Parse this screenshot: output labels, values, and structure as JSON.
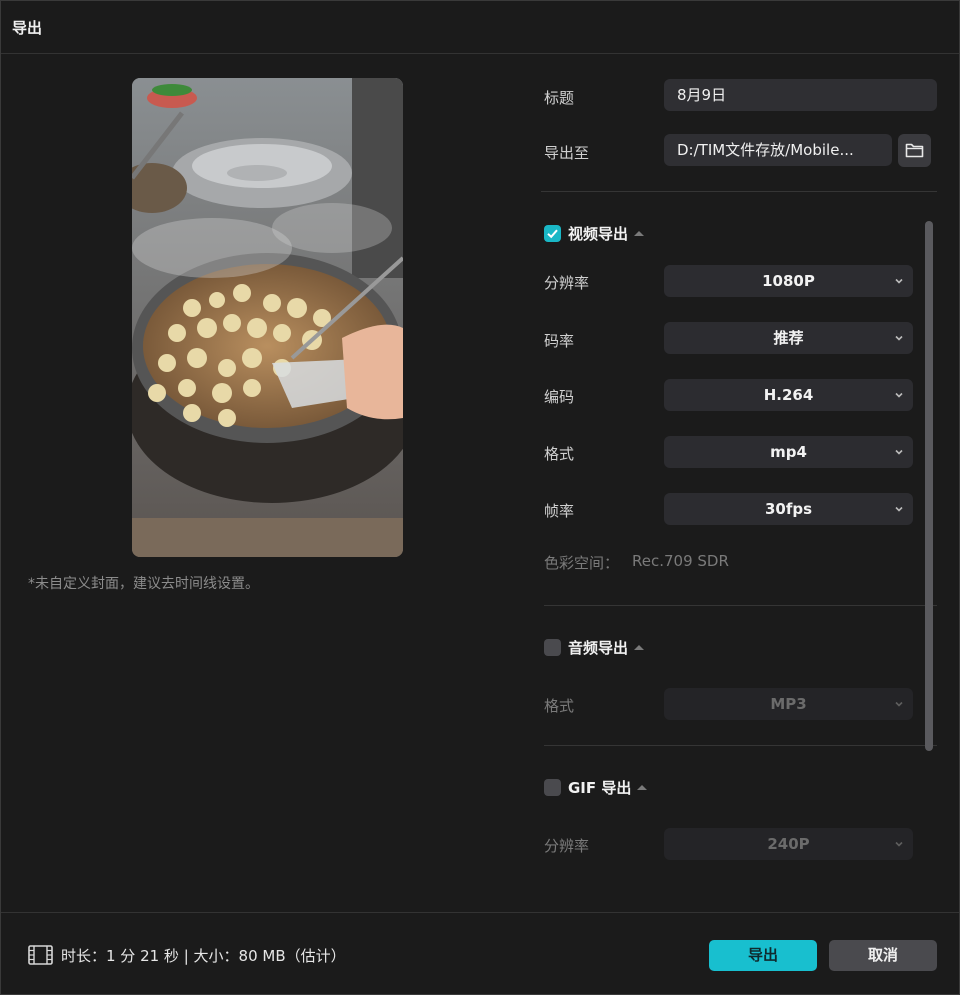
{
  "dialog": {
    "title": "导出"
  },
  "cover": {
    "note": "*未自定义封面，建议去时间线设置。"
  },
  "title_field": {
    "label": "标题",
    "value": "8月9日"
  },
  "export_to": {
    "label": "导出至",
    "value": "D:/TIM文件存放/Mobile...",
    "icon": "folder-icon"
  },
  "video": {
    "checked": true,
    "title": "视频导出",
    "resolution": {
      "label": "分辨率",
      "value": "1080P"
    },
    "bitrate": {
      "label": "码率",
      "value": "推荐"
    },
    "codec": {
      "label": "编码",
      "value": "H.264"
    },
    "format": {
      "label": "格式",
      "value": "mp4"
    },
    "framerate": {
      "label": "帧率",
      "value": "30fps"
    },
    "colorspace": {
      "label": "色彩空间：",
      "value": "Rec.709 SDR"
    }
  },
  "audio": {
    "checked": false,
    "title": "音频导出",
    "format": {
      "label": "格式",
      "value": "MP3"
    }
  },
  "gif": {
    "checked": false,
    "title": "GIF 导出",
    "resolution": {
      "label": "分辨率",
      "value": "240P"
    }
  },
  "footer": {
    "info": "时长：1 分 21 秒 | 大小：80 MB（估计）",
    "icon": "film-icon",
    "export_label": "导出",
    "cancel_label": "取消"
  },
  "colors": {
    "accent": "#18bfcf",
    "background": "#1b1b1b",
    "field": "#2f2f33"
  }
}
